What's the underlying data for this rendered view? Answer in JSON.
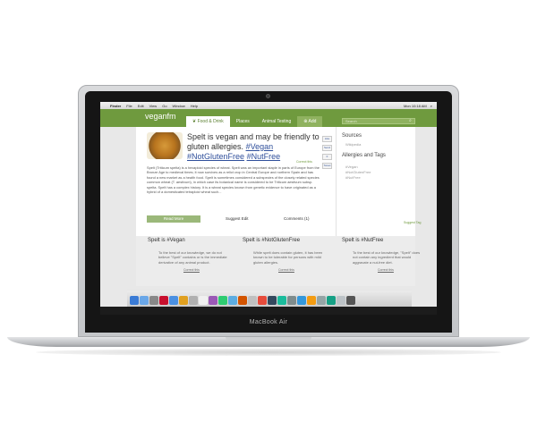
{
  "device": {
    "brand_label": "MacBook Air"
  },
  "menubar": {
    "items": [
      "Finder",
      "File",
      "Edit",
      "View",
      "Go",
      "Window",
      "Help"
    ],
    "clock": "Mon 10:18 AM"
  },
  "site": {
    "logo": "veganfm",
    "nav": [
      "Food & Drink",
      "Places",
      "Animal Testing",
      "Add"
    ],
    "search_placeholder": "Search",
    "post": {
      "title_plain": "Spelt is vegan and may be friendly to gluten allergies.",
      "tags_inline": [
        "#Vegan",
        "#NotGlutenFree",
        "#NutFree"
      ],
      "correct_link": "Correct this",
      "body": "Spelt (Triticum spelta) is a hexaploid species of wheat. Spelt was an important staple in parts of Europe from the Bronze Age to medieval times; it now survives as a relict crop in Central Europe and northern Spain and has found a new market as a health food. Spelt is sometimes considered a subspecies of the closely related species common wheat (T. aestivum), in which case its botanical name is considered to be Triticum aestivum subsp. spelta. Spelt has a complex history. It is a wheat species known from genetic evidence to have originated as a hybrid of a domesticated tetraploid wheat such...",
      "read_more": "Read More",
      "suggest_edit": "Suggest Edit",
      "comments": "Comments (1)"
    },
    "share": [
      "Like",
      "Send",
      "0",
      "Tweet"
    ],
    "sidebar": {
      "sources_title": "Sources",
      "sources": [
        "Wikipedia"
      ],
      "allergies_title": "Allergies and Tags",
      "tags": [
        "#Vegan",
        "#NotGlutenFree",
        "#NutFree"
      ],
      "suggest_tag": "Suggest Tag"
    },
    "cards": [
      {
        "title": "Spelt is #Vegan",
        "body": "To the best of our knowledge, we do not believe \"Spelt\" contains or is the immediate derivative of any animal product.",
        "link": "Correct this"
      },
      {
        "title": "Spelt is #NotGlutenFree",
        "body": "While spelt does contain gluten, it has been known to be tolerable for persons with mild gluten allergies.",
        "link": "Correct this"
      },
      {
        "title": "Spelt is #NutFree",
        "body": "To the best of our knowledge, \"Spelt\" does not contain any ingredient that would aggravate a nut-free diet.",
        "link": "Correct this"
      }
    ]
  },
  "dock": {
    "colors": [
      "#3a7bd5",
      "#6aa7e8",
      "#888888",
      "#c8102e",
      "#4a90e2",
      "#e0a020",
      "#b0b0b0",
      "#f0f0f0",
      "#9b59b6",
      "#2ecc71",
      "#5dade2",
      "#d35400",
      "#c0c0c0",
      "#e74c3c",
      "#34495e",
      "#1abc9c",
      "#7f8c8d",
      "#3498db",
      "#f39c12",
      "#95a5a6",
      "#16a085",
      "#bdc3c7",
      "#555555"
    ]
  }
}
